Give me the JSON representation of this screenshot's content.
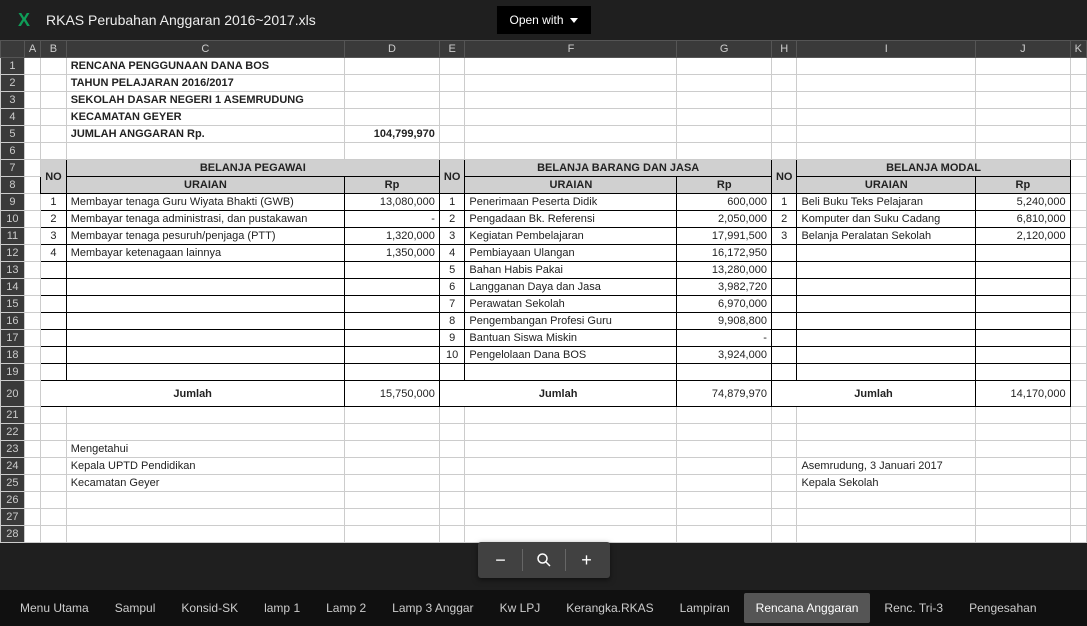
{
  "app": {
    "file_name": "RKAS Perubahan Anggaran 2016~2017.xls",
    "open_with_label": "Open with"
  },
  "columns": [
    "A",
    "B",
    "C",
    "D",
    "E",
    "F",
    "G",
    "H",
    "I",
    "J",
    "K"
  ],
  "header": {
    "l1": "RENCANA PENGGUNAAN DANA BOS",
    "l2": "TAHUN PELAJARAN 2016/2017",
    "l3": "SEKOLAH DASAR NEGERI 1 ASEMRUDUNG",
    "l4": "KECAMATAN GEYER",
    "anggaran_label": "JUMLAH ANGGARAN Rp.",
    "anggaran_value": "104,799,970"
  },
  "sections": {
    "no_label": "NO",
    "uraian_label": "URAIAN",
    "rp_label": "Rp",
    "pegawai_title": "BELANJA PEGAWAI",
    "barang_title": "BELANJA BARANG DAN JASA",
    "modal_title": "BELANJA MODAL",
    "jumlah_label": "Jumlah"
  },
  "pegawai": {
    "rows": [
      {
        "no": "1",
        "uraian": "Membayar tenaga Guru Wiyata Bhakti (GWB)",
        "rp": "13,080,000"
      },
      {
        "no": "2",
        "uraian": "Membayar tenaga administrasi, dan pustakawan",
        "rp": "-"
      },
      {
        "no": "3",
        "uraian": "Membayar tenaga pesuruh/penjaga (PTT)",
        "rp": "1,320,000"
      },
      {
        "no": "4",
        "uraian": "Membayar ketenagaan lainnya",
        "rp": "1,350,000"
      }
    ],
    "total": "15,750,000"
  },
  "barang": {
    "rows": [
      {
        "no": "1",
        "uraian": "Penerimaan Peserta Didik",
        "rp": "600,000"
      },
      {
        "no": "2",
        "uraian": "Pengadaan Bk. Referensi",
        "rp": "2,050,000"
      },
      {
        "no": "3",
        "uraian": "Kegiatan Pembelajaran",
        "rp": "17,991,500"
      },
      {
        "no": "4",
        "uraian": "Pembiayaan Ulangan",
        "rp": "16,172,950"
      },
      {
        "no": "5",
        "uraian": "Bahan Habis Pakai",
        "rp": "13,280,000"
      },
      {
        "no": "6",
        "uraian": "Langganan Daya dan Jasa",
        "rp": "3,982,720"
      },
      {
        "no": "7",
        "uraian": "Perawatan Sekolah",
        "rp": "6,970,000"
      },
      {
        "no": "8",
        "uraian": "Pengembangan Profesi Guru",
        "rp": "9,908,800"
      },
      {
        "no": "9",
        "uraian": "Bantuan Siswa Miskin",
        "rp": "-"
      },
      {
        "no": "10",
        "uraian": "Pengelolaan Dana BOS",
        "rp": "3,924,000"
      }
    ],
    "total": "74,879,970"
  },
  "modal": {
    "rows": [
      {
        "no": "1",
        "uraian": "Beli Buku Teks Pelajaran",
        "rp": "5,240,000"
      },
      {
        "no": "2",
        "uraian": "Komputer dan Suku Cadang",
        "rp": "6,810,000"
      },
      {
        "no": "3",
        "uraian": "Belanja Peralatan Sekolah",
        "rp": "2,120,000"
      }
    ],
    "total": "14,170,000"
  },
  "footer": {
    "mengetahui": "Mengetahui",
    "kepala_uptd": "Kepala UPTD Pendidikan",
    "kecamatan": "Kecamatan Geyer",
    "place_date": "Asemrudung, 3 Januari 2017",
    "kepala_sekolah": "Kepala Sekolah"
  },
  "tabs": [
    "Menu Utama",
    "Sampul",
    "Konsid-SK",
    "lamp 1",
    "Lamp 2",
    "Lamp 3 Anggar",
    "Kw LPJ",
    "Kerangka.RKAS",
    "Lampiran",
    "Rencana Anggaran",
    "Renc. Tri-3",
    "Pengesahan"
  ],
  "active_tab": 9,
  "zoom": {
    "minus": "−",
    "lens": "search",
    "plus": "+"
  }
}
